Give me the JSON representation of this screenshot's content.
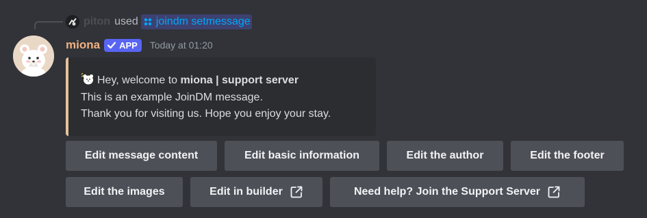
{
  "reply": {
    "username": "piton",
    "used_text": "used",
    "command": "joindm setmessage"
  },
  "message": {
    "username": "miona",
    "badge": "APP",
    "timestamp": "Today at 01:20",
    "accent_color": "#e7c19b",
    "username_color": "#f0b182"
  },
  "embed": {
    "line1_prefix": "Hey, welcome to ",
    "line1_bold": "miona | support server",
    "line2": "This is an example JoinDM message.",
    "line3": "Thank you for visiting us. Hope you enjoy your stay."
  },
  "buttons": {
    "row1": [
      "Edit message content",
      "Edit basic information",
      "Edit the author",
      "Edit the footer"
    ],
    "row2": [
      "Edit the images",
      "Edit in builder",
      "Need help? Join the Support Server"
    ],
    "external_link_icon": "external-link-icon"
  }
}
